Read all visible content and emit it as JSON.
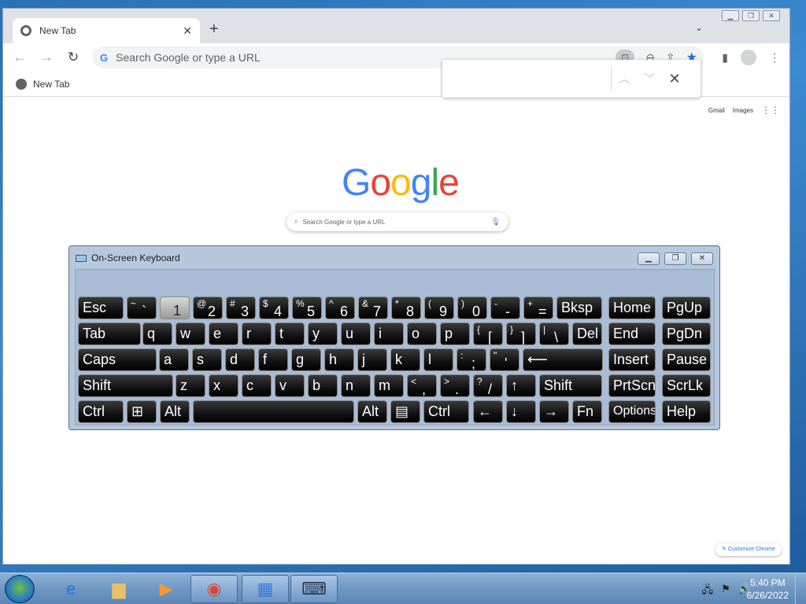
{
  "browser": {
    "tab_title": "New Tab",
    "omnibox_placeholder": "Search Google or type a URL",
    "bookmark_label": "New Tab",
    "find_value": "",
    "ntp_links": [
      "Gmail",
      "Images"
    ],
    "logo_letters": [
      "G",
      "o",
      "o",
      "g",
      "l",
      "e"
    ],
    "ntp_search_placeholder": "Search Google or type a URL",
    "customize_label": "Customize Chrome"
  },
  "osk": {
    "title": "On-Screen Keyboard",
    "pressed_key": "1",
    "rows": [
      [
        {
          "t": "Esc"
        },
        {
          "s": "~",
          "t": "`"
        },
        {
          "t": "1"
        },
        {
          "s": "@",
          "t": "2"
        },
        {
          "s": "#",
          "t": "3"
        },
        {
          "s": "$",
          "t": "4"
        },
        {
          "s": "%",
          "t": "5"
        },
        {
          "s": "^",
          "t": "6"
        },
        {
          "s": "&",
          "t": "7"
        },
        {
          "s": "*",
          "t": "8"
        },
        {
          "s": "(",
          "t": "9"
        },
        {
          "s": ")",
          "t": "0"
        },
        {
          "s": "-",
          "t": "-"
        },
        {
          "s": "+",
          "t": "="
        },
        {
          "t": "Bksp"
        },
        {
          "t": "Home"
        },
        {
          "t": "PgUp"
        }
      ],
      [
        {
          "t": "Tab"
        },
        {
          "t": "q"
        },
        {
          "t": "w"
        },
        {
          "t": "e"
        },
        {
          "t": "r"
        },
        {
          "t": "t"
        },
        {
          "t": "y"
        },
        {
          "t": "u"
        },
        {
          "t": "i"
        },
        {
          "t": "o"
        },
        {
          "t": "p"
        },
        {
          "s": "{",
          "t": "["
        },
        {
          "s": "}",
          "t": "]"
        },
        {
          "s": "|",
          "t": "\\"
        },
        {
          "t": "Del"
        },
        {
          "t": "End"
        },
        {
          "t": "PgDn"
        }
      ],
      [
        {
          "t": "Caps"
        },
        {
          "t": "a"
        },
        {
          "t": "s"
        },
        {
          "t": "d"
        },
        {
          "t": "f"
        },
        {
          "t": "g"
        },
        {
          "t": "h"
        },
        {
          "t": "j"
        },
        {
          "t": "k"
        },
        {
          "t": "l"
        },
        {
          "s": ":",
          "t": ";"
        },
        {
          "s": "\"",
          "t": "'"
        },
        {
          "t": "⟵"
        },
        {
          "t": "Insert"
        },
        {
          "t": "Pause"
        }
      ],
      [
        {
          "t": "Shift"
        },
        {
          "t": "z"
        },
        {
          "t": "x"
        },
        {
          "t": "c"
        },
        {
          "t": "v"
        },
        {
          "t": "b"
        },
        {
          "t": "n"
        },
        {
          "t": "m"
        },
        {
          "s": "<",
          "t": ","
        },
        {
          "s": ">",
          "t": "."
        },
        {
          "s": "?",
          "t": "/"
        },
        {
          "t": "↑"
        },
        {
          "t": "Shift"
        },
        {
          "t": "PrtScn"
        },
        {
          "t": "ScrLk"
        }
      ],
      [
        {
          "t": "Ctrl"
        },
        {
          "t": "⊞"
        },
        {
          "t": "Alt"
        },
        {
          "t": ""
        },
        {
          "t": "Alt"
        },
        {
          "t": "▤"
        },
        {
          "t": "Ctrl"
        },
        {
          "t": "←"
        },
        {
          "t": "↓"
        },
        {
          "t": "→"
        },
        {
          "t": "Fn"
        },
        {
          "t": "Options"
        },
        {
          "t": "Help"
        }
      ]
    ]
  },
  "taskbar": {
    "apps": [
      "internet-explorer",
      "windows-explorer",
      "media-player",
      "chrome",
      "control-panel",
      "on-screen-keyboard"
    ],
    "time": "5:40 PM",
    "date": "6/26/2022"
  }
}
